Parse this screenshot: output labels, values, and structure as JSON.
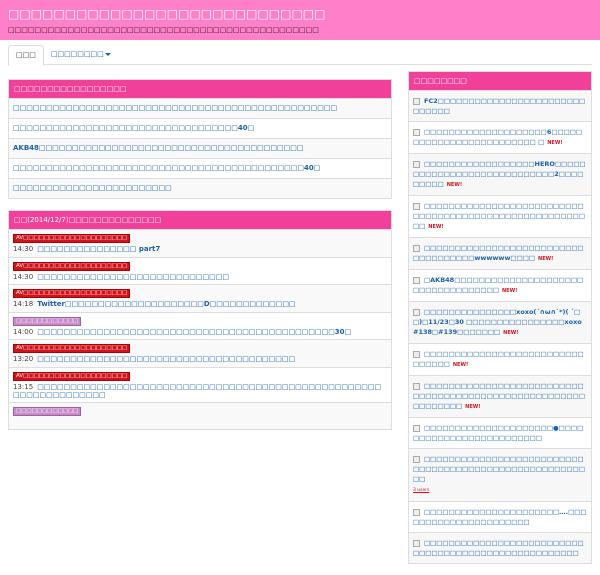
{
  "header": {
    "title": "□□□□□□□□□□□□□□□□□□□□□□□□□□□□",
    "subtitle": "□□□□□□□□□□□□□□□□□□□□□□□□□□□□□□□□□□□□□□□□□□□□□□□"
  },
  "nav": {
    "tabs": [
      {
        "label": "□□□"
      },
      {
        "label": "□□□□□□□□"
      }
    ]
  },
  "popular": {
    "title": "□□□□□□□□□□□□□□□□□",
    "items": [
      "□□□□□□□□□□□□□□□□□□□□□□□□□□□□□□□□□□□□□□□□□□□□□□□□□",
      "□□□□□□□□□□□□□□□□□□□□□□□□□□□□□□□□□□40□",
      "AKB48□□□□□□□□□□□□□□□□□□□□□□□□□□□□□□□□□□□□□□□□",
      "□□□□□□□□□□□□□□□□□□□□□□□□□□□□□□□□□□□□□□□□□□□□40□",
      "□□□□□□□□□□□□□□□□□□□□□□□□"
    ]
  },
  "today": {
    "title": "□□(2014/12/7)□□□□□□□□□□□□□□",
    "items": [
      {
        "label": "AV□□□□□□□□□□□□□□□□□□□□",
        "label_color": "red",
        "time": "14:30",
        "text": "□□□□□□□□□□□□□□□ part7"
      },
      {
        "label": "AV□□□□□□□□□□□□□□□□□□□□",
        "label_color": "red",
        "time": "14:30",
        "text": "□□□□□□□□□□□□□□□□□□□□□□□□□□□□□"
      },
      {
        "label": "AV□□□□□□□□□□□□□□□□□□□□",
        "label_color": "red",
        "time": "14:18",
        "text": "Twitter□□□□□□□□□□□□□□□□□□□□□D□□□□□□□□□□□□□"
      },
      {
        "label": "□□□□□□□□□□□□",
        "label_color": "purple",
        "time": "14:00",
        "text": "□□□□□□□□□□□□□□□□□□□□□□□□□□□□□□□□□□□□□□□□□□□□□30□"
      },
      {
        "label": "AV□□□□□□□□□□□□□□□□□□□□",
        "label_color": "red",
        "time": "13:20",
        "text": "□□□□□□□□□□□□□□□□□□□□□□□□□□□□□□□□□□□□□□□"
      },
      {
        "label": "AV□□□□□□□□□□□□□□□□□□□□",
        "label_color": "red",
        "time": "13:15",
        "text": "□□□□□□□□□□□□□□□□□□□□□□□□□□□□□□□□□□□□□□□□□□□□□□□□□□□□□□□□□□□□□□□□□□"
      },
      {
        "label": "□□□□□□□□□□□□",
        "label_color": "purple",
        "time": "",
        "text": ""
      }
    ]
  },
  "sidebar": {
    "title": "□□□□□□□□",
    "new_badge": "NEW!",
    "items": [
      {
        "text": "FC2□□□□□□□□□□□□□□□□□□□□□□□□□□□□□□",
        "new": false
      },
      {
        "text": "□□□□□□□□□□□□□□□□□□□□6□□□□□□□□□□□□□□□□□□□□□□□□□ □",
        "new": true
      },
      {
        "text": "□□□□□□□□□□□□□□□□□□HERO□□□□□□□□□□□□□□□□□□□□□□□□□□□□2□□□□□□□□□",
        "new": true
      },
      {
        "text": "□□□□□□□□□□□□□□□□□□□□□□□□□□□□□□□□□□□□□□□□□□□□□□□□□□□□□□□□",
        "new": true
      },
      {
        "text": "□□□□□□□□□□□□□□□□□□□□□□□□□□□□□□□□□□□□wwwwww□□□□",
        "new": true
      },
      {
        "text": "□AKB48□□□□□□□□□□□□□□□□□□□□□□□□□□□□□□□□□□□",
        "new": true
      },
      {
        "text": "□□□□□□□□□□□□□□□xoxo(´∩ω∩`*)( ´□□)□11/23□30 □□□□□□□□□□□□□□□□xoxo #138□#139□□□□□□□",
        "new": true
      },
      {
        "text": "□□□□□□□□□□□□□□□□□□□□□□□□□□□□□□□□",
        "new": true
      },
      {
        "text": "□□□□□□□□□□□□□□□□□□□□□□□□□□□□□□□□□□□□□□□□□□□□□□□□□□□□□□□□□□□□□□",
        "new": true
      },
      {
        "text": "□□□□□□□□□□□□□□□□□□□□□●□□□□□□□□□□□□□□□□□□□□□□□□□",
        "new": false
      },
      {
        "text": "□□□□□□□□□□□□□□□□□□□□□□□□□□□□□□□□□□□□□□□□□□□□□□□□□□□□□□□□",
        "new": false,
        "users": "3 users"
      },
      {
        "text": "□□□□□□□□□□□□□□□□□□□□□□….□□□□□□□□□□□□□□□□□□□□□□",
        "new": false
      },
      {
        "text": "□□□□□□□□□□□□□□□□□□□□□□□□□□□□□□□□□□□□□□□□□□□□□□□□□□□□□",
        "new": false
      }
    ]
  }
}
